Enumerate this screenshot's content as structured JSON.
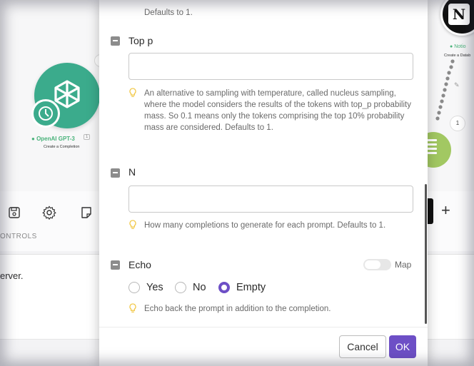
{
  "canvas": {
    "openai_module": {
      "title": "OpenAI GPT-3",
      "subtitle": "Create a Completion",
      "badge": "1"
    },
    "notion_module": {
      "title": "Notio",
      "subtitle": "Create a Datab",
      "letter": "N"
    },
    "router_count": "1"
  },
  "toolbar": {
    "controls_label": "ONTROLS",
    "plus": "+"
  },
  "log": {
    "text": "erver."
  },
  "modal": {
    "prev_help_tail": "Defaults to 1.",
    "top_p": {
      "label": "Top p",
      "value": "",
      "help": "An alternative to sampling with temperature, called nucleus sampling, where the model considers the results of the tokens with top_p probability mass. So 0.1 means only the tokens comprising the top 10% probability mass are considered. Defaults to 1."
    },
    "n": {
      "label": "N",
      "value": "",
      "help": "How many completions to generate for each prompt. Defaults to 1."
    },
    "echo": {
      "label": "Echo",
      "map_label": "Map",
      "options": [
        "Yes",
        "No",
        "Empty"
      ],
      "selected": "Empty",
      "help": "Echo back the prompt in addition to the completion."
    },
    "buttons": {
      "cancel": "Cancel",
      "ok": "OK"
    }
  },
  "colors": {
    "accent": "#6d4fc6",
    "openai_green": "#3bab8c",
    "status_green": "#49b27a",
    "help_bulb": "#f2c94c"
  }
}
